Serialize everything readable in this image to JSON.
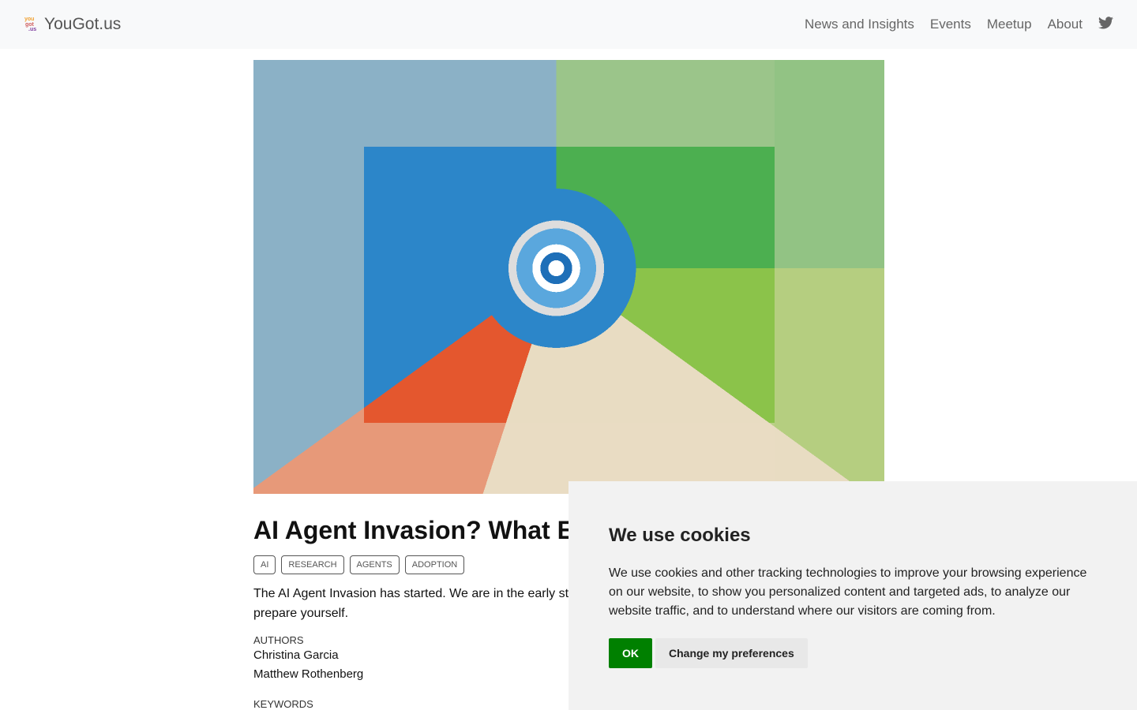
{
  "nav": {
    "brand": "YouGot.us",
    "links": [
      "News and Insights",
      "Events",
      "Meetup",
      "About"
    ],
    "twitter_icon": "twitter-icon"
  },
  "article": {
    "title": "AI Agent Invasion? What Exp",
    "tags": [
      "AI",
      "RESEARCH",
      "AGENTS",
      "ADOPTION"
    ],
    "description": "The AI Agent Invasion has started. We are in the early sta",
    "description_line2": "prepare yourself.",
    "authors_label": "AUTHORS",
    "authors": [
      "Christina Garcia",
      "Matthew Rothenberg"
    ],
    "keywords_label": "KEYWORDS"
  },
  "cookie": {
    "title": "We use cookies",
    "text": "We use cookies and other tracking technologies to improve your browsing experience on our website, to show you personalized content and targeted ads, to analyze our website traffic, and to understand where our visitors are coming from.",
    "ok": "OK",
    "preferences": "Change my preferences",
    "ok_color": "#008000"
  }
}
